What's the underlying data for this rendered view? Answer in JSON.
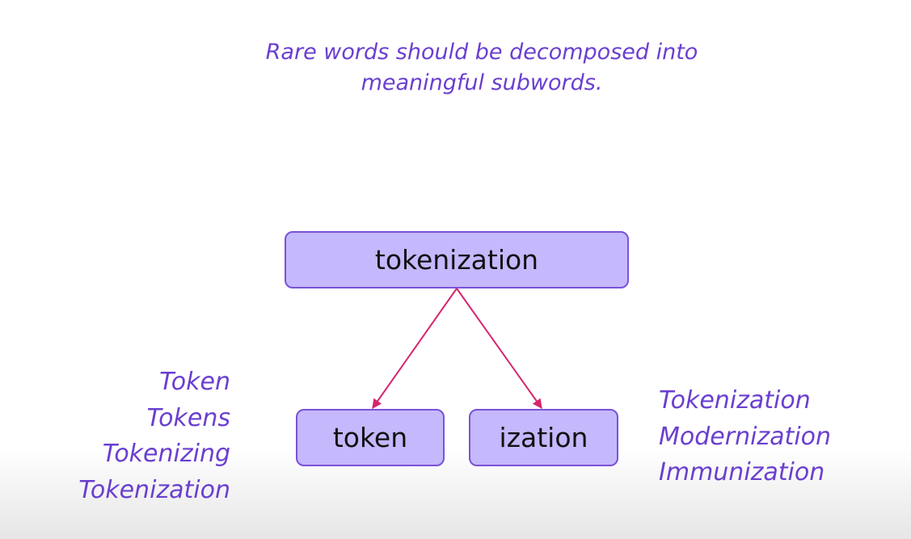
{
  "caption": {
    "line1": "Rare words should be decomposed into",
    "line2": "meaningful subwords."
  },
  "diagram": {
    "root": "tokenization",
    "children": [
      "token",
      "ization"
    ]
  },
  "examples_left": [
    "Token",
    "Tokens",
    "Tokenizing",
    "Tokenization"
  ],
  "examples_right": [
    "Tokenization",
    "Modernization",
    "Immunization"
  ],
  "colors": {
    "box_fill": "#c5b8fd",
    "box_border": "#7a52d9",
    "text_accent": "#6a3fd0",
    "arrow": "#d6246e"
  }
}
